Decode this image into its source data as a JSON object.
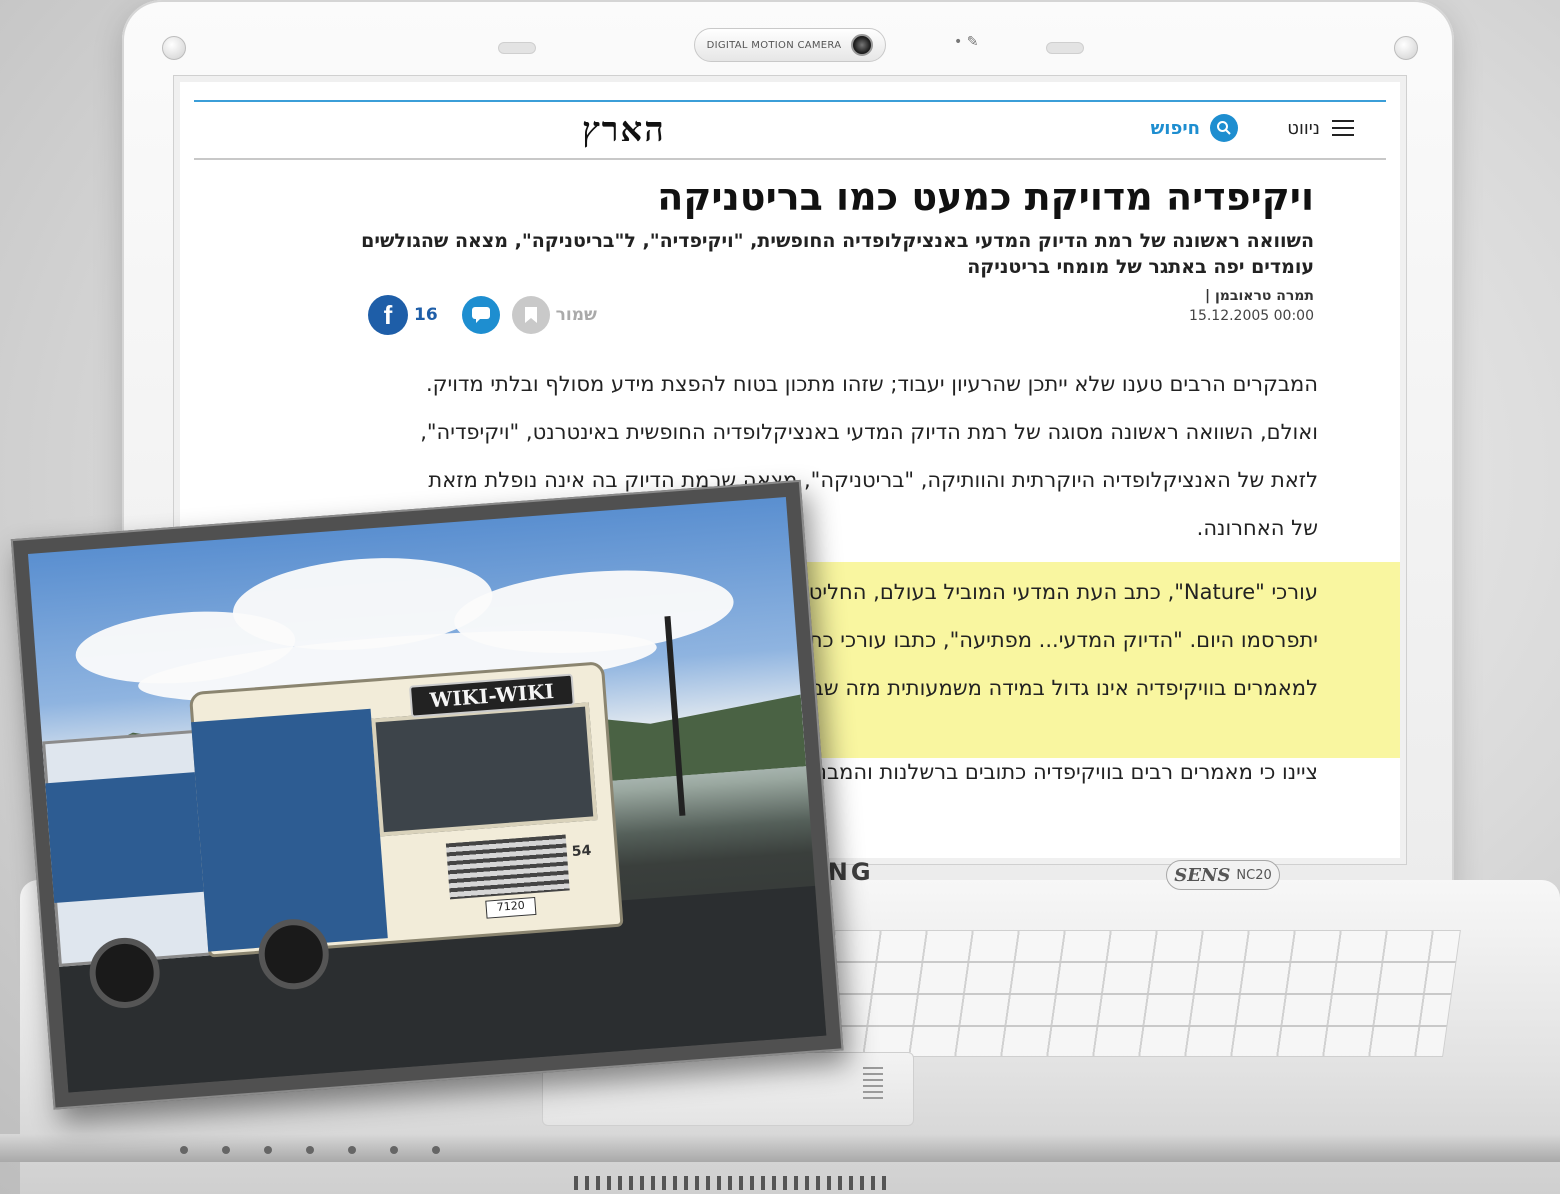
{
  "laptop": {
    "camera_label": "DIGITAL MOTION CAMERA",
    "brand_visible": "SUNG",
    "model_brand": "SENS",
    "model_number": "NC20"
  },
  "site": {
    "logo": "הארץ",
    "nav": {
      "menu_label": "ניווט",
      "search_label": "חיפוש"
    },
    "colors": {
      "accent": "#1e8ed0",
      "facebook": "#1e5ea8",
      "highlight": "#f9f6a0"
    }
  },
  "article": {
    "headline": "ויקיפדיה מדויקת כמעט כמו בריטניקה",
    "subheadline": "השוואה ראשונה של רמת הדיוק המדעי באנציקלופדיה החופשית, \"ויקיפדיה\", ל\"בריטניקה\", מצאה שהגולשים עומדים יפה באתגר של מומחי בריטניקה",
    "author": "תמרה טראובמן |",
    "date": "15.12.2005 00:00",
    "actions": {
      "save_label": "שמור",
      "facebook_count": "16",
      "facebook_glyph": "f"
    },
    "paragraph_1": "המבקרים הרבים טענו שלא ייתכן שהרעיון יעבוד; שזהו מתכון בטוח להפצת מידע מסולף ובלתי מדויק. ואולם, השוואה ראשונה מסוגה של רמת הדיוק המדעי באנציקלופדיה החופשית באינטרנט, \"ויקיפדיה\", לזאת של האנציקלופדיה היוקרתית והוותיקה, \"בריטניקה\", מצאה שרמת הדיוק בה אינה נופלת מזאת של האחרונה.",
    "paragraph_2": "עורכי \"Nature\", כתב העת המדעי המוביל בעולם, החליטו לבדוק את האנציקלופדיות. ממצאי הבדיקה יתפרסמו היום. \"הדיוק המדעי... מפתיעה\", כתבו עורכי כתב העת במאמר מערכת שנלווה לפרסום... למאמרים בוויקיפדיה אינו גדול במידה משמעותית מזה שבאנציקלופדיה",
    "paragraph_3": "ציינו כי מאמרים רבים בוויקיפדיה כתובים ברשלנות והמבנה"
  },
  "photo": {
    "bus_sign": "WIKI-WIKI",
    "bus_number": "54",
    "plate": "7120"
  }
}
